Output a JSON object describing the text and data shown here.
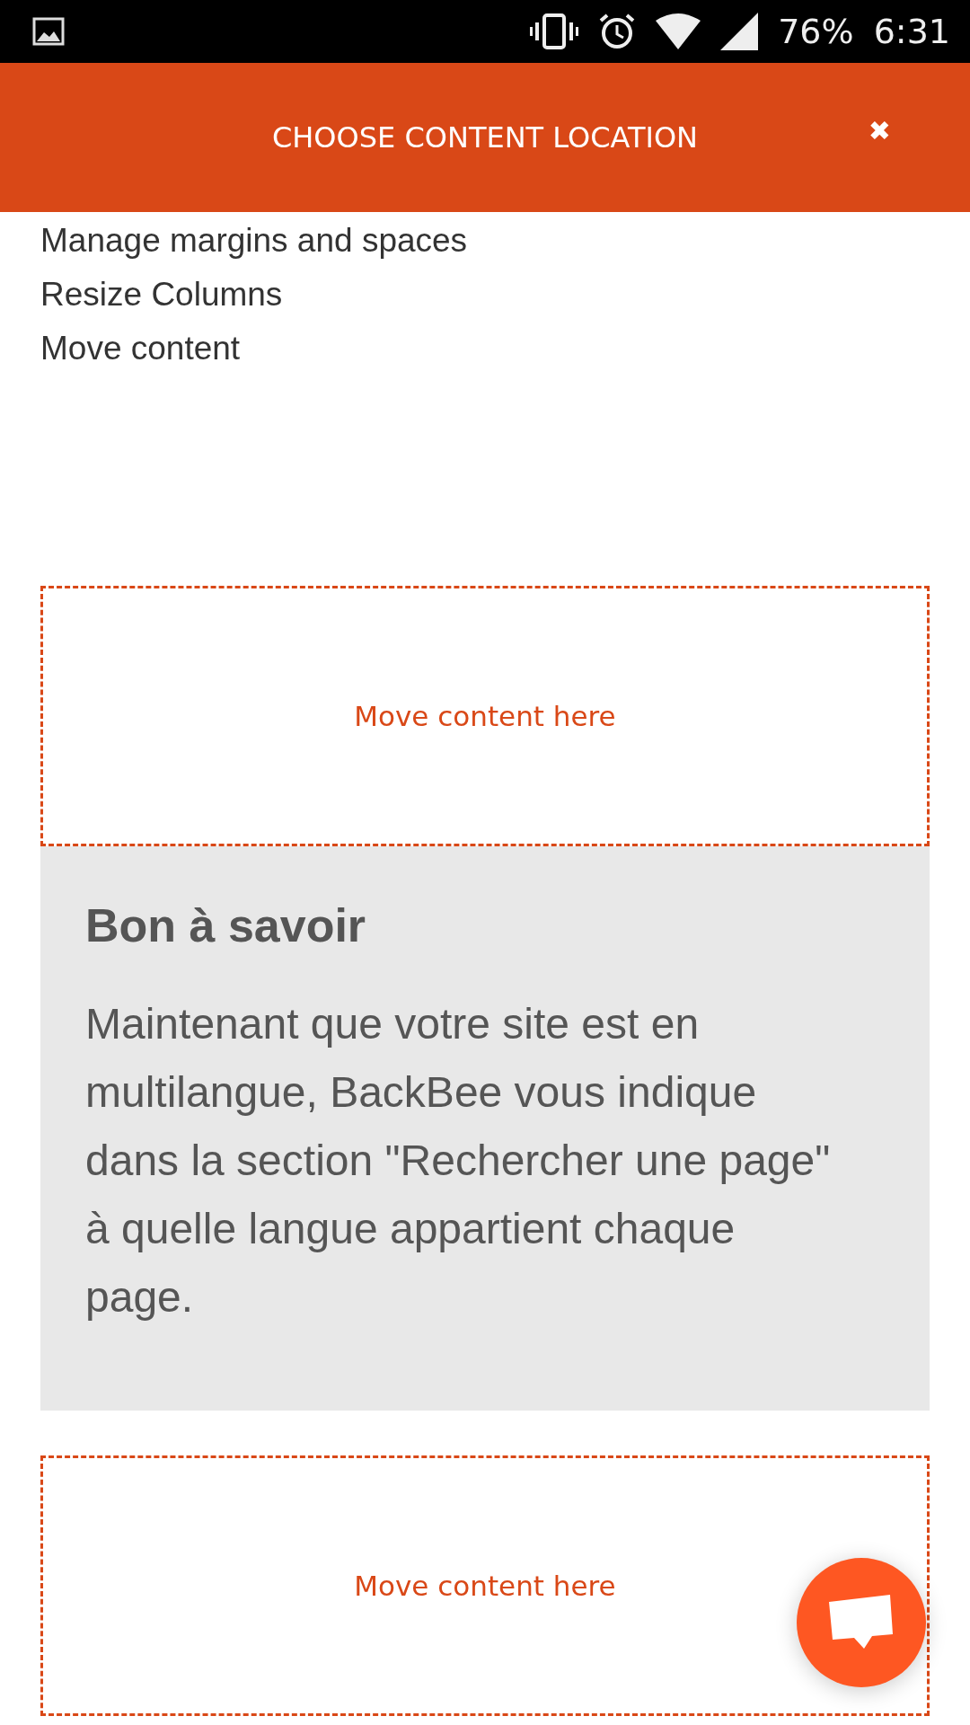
{
  "status_bar": {
    "battery": "76%",
    "time": "6:31"
  },
  "header": {
    "title": "CHOOSE CONTENT LOCATION",
    "close": "✖"
  },
  "menu_items": [
    "Manage margins and spaces",
    "Resize Columns",
    "Move content"
  ],
  "drop_zones": [
    {
      "label": "Move content here"
    },
    {
      "label": "Move content here"
    }
  ],
  "info_box": {
    "title": "Bon à savoir",
    "text": "Maintenant que votre site est en multilangue, BackBee vous indique dans la section \"Rechercher une page\" à quelle langue appartient chaque page."
  }
}
